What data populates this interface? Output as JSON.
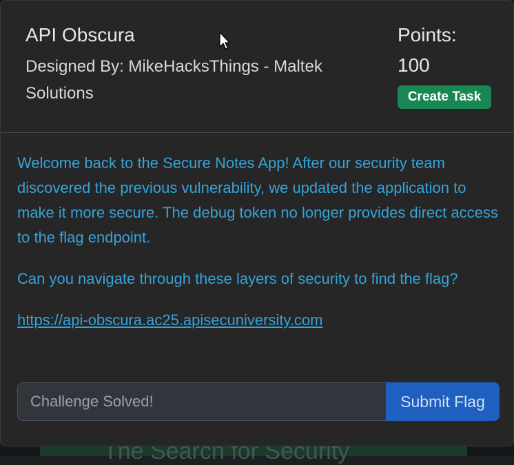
{
  "challenge": {
    "title": "API Obscura",
    "designer": "Designed By: MikeHacksThings - Maltek Solutions",
    "points_label": "Points:",
    "points_value": "100",
    "create_task_label": "Create Task"
  },
  "description": {
    "paragraph_1": "Welcome back to the Secure Notes App! After our security team discovered the previous vulnerability, we updated the application to make it more secure. The debug token no longer provides direct access to the flag endpoint.",
    "paragraph_2": "Can you navigate through these layers of security to find the flag?",
    "link": "https://api-obscura.ac25.apisecuniversity.com"
  },
  "flag_form": {
    "placeholder": "Challenge Solved!",
    "submit_label": "Submit Flag"
  },
  "background": {
    "partial_text": "The Search for Security"
  },
  "colors": {
    "modal_bg": "#262626",
    "accent_text": "#36a3d9",
    "success": "#198754",
    "primary": "#1f5fbf"
  }
}
